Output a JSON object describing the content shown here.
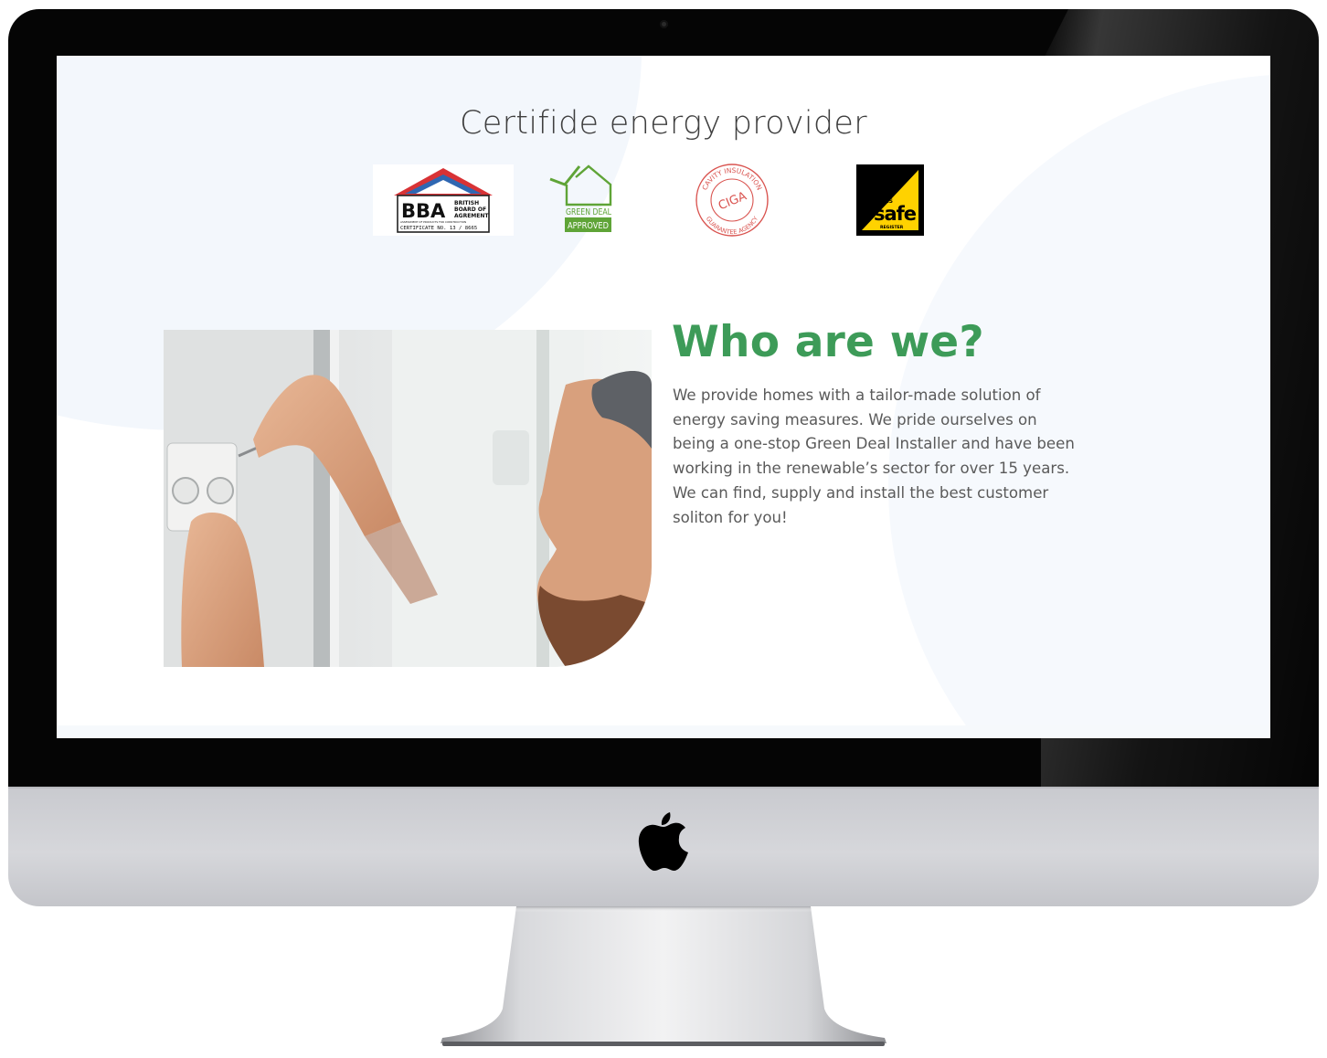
{
  "certifications": {
    "title": "Certifide energy provider",
    "logos": [
      {
        "name": "BBA",
        "lines": [
          "BBA",
          "BRITISH",
          "BOARD OF",
          "AGREMENT",
          "ASSESSMENT OF PRODUCTS FOR CONSTRUCTION",
          "CERTIFICATE NO. 13 / 8665"
        ],
        "colors": {
          "roof": "#d83235",
          "roof_inner": "#2f67b2",
          "text": "#111111"
        }
      },
      {
        "name": "Green Deal Approved",
        "lines": [
          "GREEN DEAL",
          "APPROVED"
        ],
        "colors": {
          "green": "#5fa437"
        }
      },
      {
        "name": "CIGA",
        "lines": [
          "CAVITY INSULATION",
          "CIGA",
          "GUARANTEE AGENCY"
        ],
        "colors": {
          "red": "#d9534f"
        }
      },
      {
        "name": "Gas Safe Register",
        "lines": [
          "GAS",
          "safe",
          "REGISTER"
        ],
        "colors": {
          "yellow": "#ffd200",
          "black": "#000000"
        }
      }
    ]
  },
  "about": {
    "heading": "Who are we?",
    "body": "We provide homes with a tailor-made solution of energy saving measures. We pride ourselves on being a one-stop Green Deal Installer and have been working in the renewable’s sector for over 15 years. We can find, supply and install the best customer soliton for you!"
  },
  "theme": {
    "accent": "#3d9b58",
    "text": "#5a5a5a",
    "background_shape": "#f3f7fc"
  }
}
